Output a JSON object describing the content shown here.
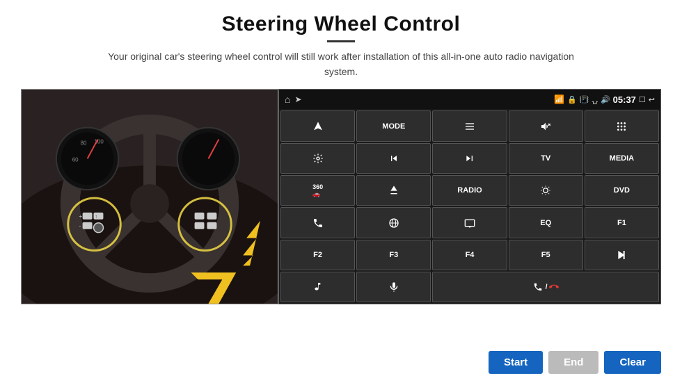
{
  "title": "Steering Wheel Control",
  "divider": true,
  "subtitle": "Your original car's steering wheel control will still work after installation of this all-in-one auto radio navigation system.",
  "status_bar": {
    "time": "05:37",
    "icons": [
      "home",
      "wifi",
      "lock",
      "sim",
      "bluetooth",
      "volume",
      "window",
      "back"
    ]
  },
  "grid_buttons": [
    {
      "id": "nav",
      "icon": "navigate",
      "label": ""
    },
    {
      "id": "mode",
      "icon": "",
      "label": "MODE"
    },
    {
      "id": "list",
      "icon": "list",
      "label": ""
    },
    {
      "id": "mute",
      "icon": "mute",
      "label": ""
    },
    {
      "id": "apps",
      "icon": "apps",
      "label": ""
    },
    {
      "id": "settings",
      "icon": "settings",
      "label": ""
    },
    {
      "id": "prev",
      "icon": "prev",
      "label": ""
    },
    {
      "id": "next",
      "icon": "next",
      "label": ""
    },
    {
      "id": "tv",
      "icon": "",
      "label": "TV"
    },
    {
      "id": "media",
      "icon": "",
      "label": "MEDIA"
    },
    {
      "id": "camera360",
      "icon": "360",
      "label": ""
    },
    {
      "id": "eject",
      "icon": "eject",
      "label": ""
    },
    {
      "id": "radio",
      "icon": "",
      "label": "RADIO"
    },
    {
      "id": "brightness",
      "icon": "brightness",
      "label": ""
    },
    {
      "id": "dvd",
      "icon": "",
      "label": "DVD"
    },
    {
      "id": "phone",
      "icon": "phone",
      "label": ""
    },
    {
      "id": "browser",
      "icon": "browser",
      "label": ""
    },
    {
      "id": "screen",
      "icon": "screen",
      "label": ""
    },
    {
      "id": "eq",
      "icon": "",
      "label": "EQ"
    },
    {
      "id": "f1",
      "icon": "",
      "label": "F1"
    },
    {
      "id": "f2",
      "icon": "",
      "label": "F2"
    },
    {
      "id": "f3",
      "icon": "",
      "label": "F3"
    },
    {
      "id": "f4",
      "icon": "",
      "label": "F4"
    },
    {
      "id": "f5",
      "icon": "",
      "label": "F5"
    },
    {
      "id": "playpause",
      "icon": "playpause",
      "label": ""
    },
    {
      "id": "music",
      "icon": "music",
      "label": ""
    },
    {
      "id": "mic",
      "icon": "mic",
      "label": ""
    },
    {
      "id": "call",
      "icon": "call",
      "label": ""
    }
  ],
  "buttons": {
    "start": "Start",
    "end": "End",
    "clear": "Clear"
  },
  "colors": {
    "title_bg": "#ffffff",
    "panel_bg": "#1a1a1a",
    "btn_bg": "#2d2d2d",
    "btn_active": "#1565c0",
    "btn_disabled": "#bbbbbb"
  }
}
